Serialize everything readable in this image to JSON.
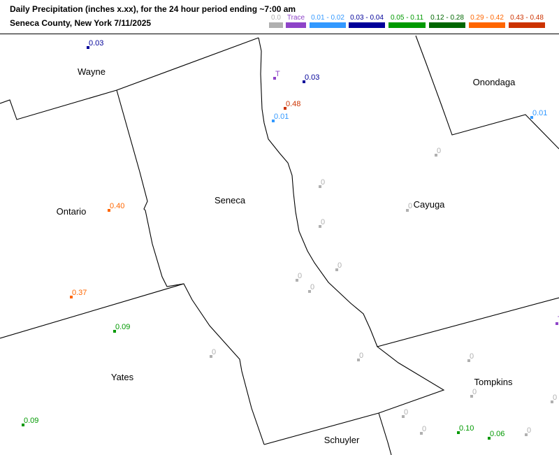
{
  "header": {
    "title_line1": "Daily Precipitation (inches  x.xx),  for the 24 hour period ending ~7:00 am",
    "title_line2": "Seneca County, New York  7/11/2025"
  },
  "legend": [
    {
      "label": "0.0",
      "color": "#b0b0b0"
    },
    {
      "label": "Trace",
      "color": "#8e44c8"
    },
    {
      "label": "0.01 - 0.02",
      "color": "#3399ff"
    },
    {
      "label": "0.03 - 0.04",
      "color": "#000099"
    },
    {
      "label": "0.05 - 0.11",
      "color": "#009900"
    },
    {
      "label": "0.12 - 0.28",
      "color": "#006600"
    },
    {
      "label": "0.29 - 0.42",
      "color": "#ff6600"
    },
    {
      "label": "0.43 - 0.48",
      "color": "#cc3300"
    }
  ],
  "counties": [
    "Wayne",
    "Onondaga",
    "Ontario",
    "Seneca",
    "Cayuga",
    "Yates",
    "Tompkins",
    "Schuyler"
  ],
  "observations": [
    "0.03",
    "T",
    "0.03",
    "0.48",
    "0.01",
    "0.01",
    "0",
    "0",
    "0.40",
    "0",
    "0",
    "0",
    "0",
    "0.37",
    "0",
    "0.09",
    "T",
    "0",
    "0",
    "0",
    "0",
    "0",
    "0.09",
    "0",
    "0",
    "0.10",
    "0.06",
    "0"
  ]
}
